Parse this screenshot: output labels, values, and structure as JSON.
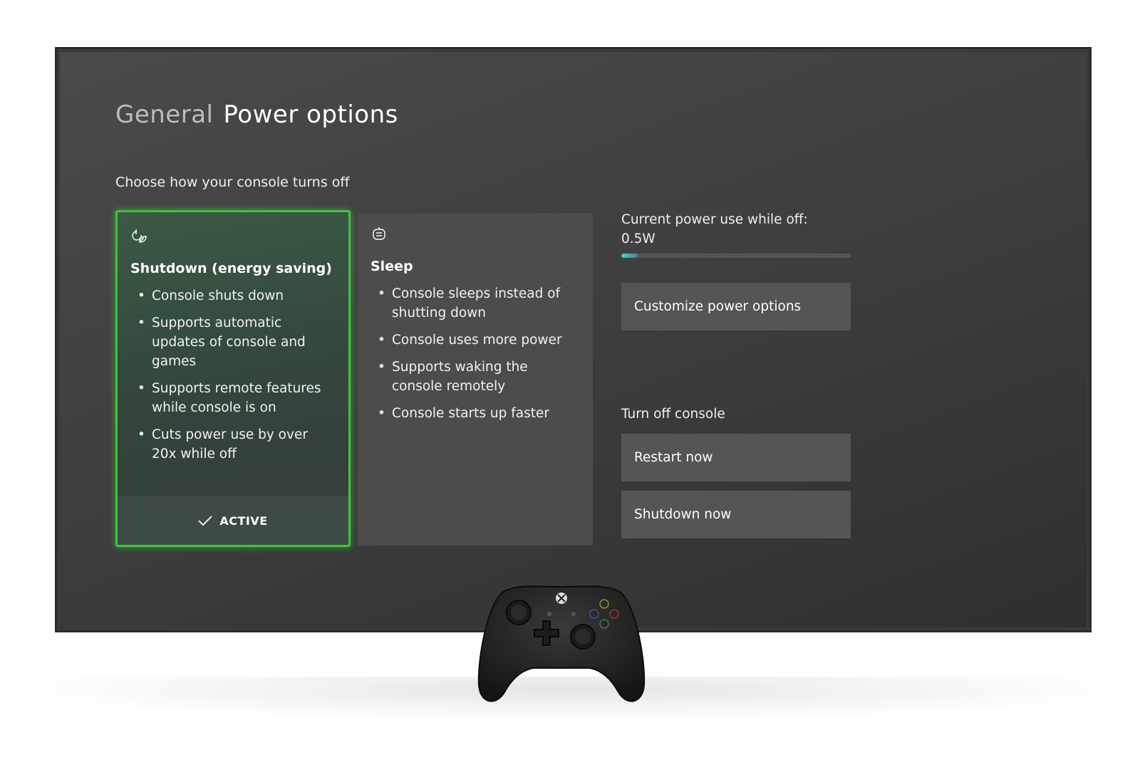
{
  "header": {
    "section": "General",
    "title": "Power options"
  },
  "subtitle": "Choose how your console turns off",
  "cards": {
    "shutdown": {
      "icon": "leaf-power-icon",
      "title": "Shutdown (energy saving)",
      "bullets": [
        "Console shuts down",
        "Supports automatic updates of console and games",
        "Supports remote features while console is on",
        "Cuts power use by over 20x while off"
      ],
      "status_label": "ACTIVE"
    },
    "sleep": {
      "icon": "sleep-icon",
      "title": "Sleep",
      "bullets": [
        "Console sleeps instead of shutting down",
        "Console uses more power",
        "Supports waking the console remotely",
        "Console starts up faster"
      ]
    }
  },
  "power": {
    "label": "Current power use while off:",
    "value": "0.5W",
    "level_fraction": 0.07
  },
  "customize_button": "Customize power options",
  "turn_off": {
    "label": "Turn off console",
    "restart": "Restart now",
    "shutdown": "Shutdown now"
  },
  "colors": {
    "active_border": "#3fc43b",
    "meter_accent": "#4fd1c0"
  }
}
